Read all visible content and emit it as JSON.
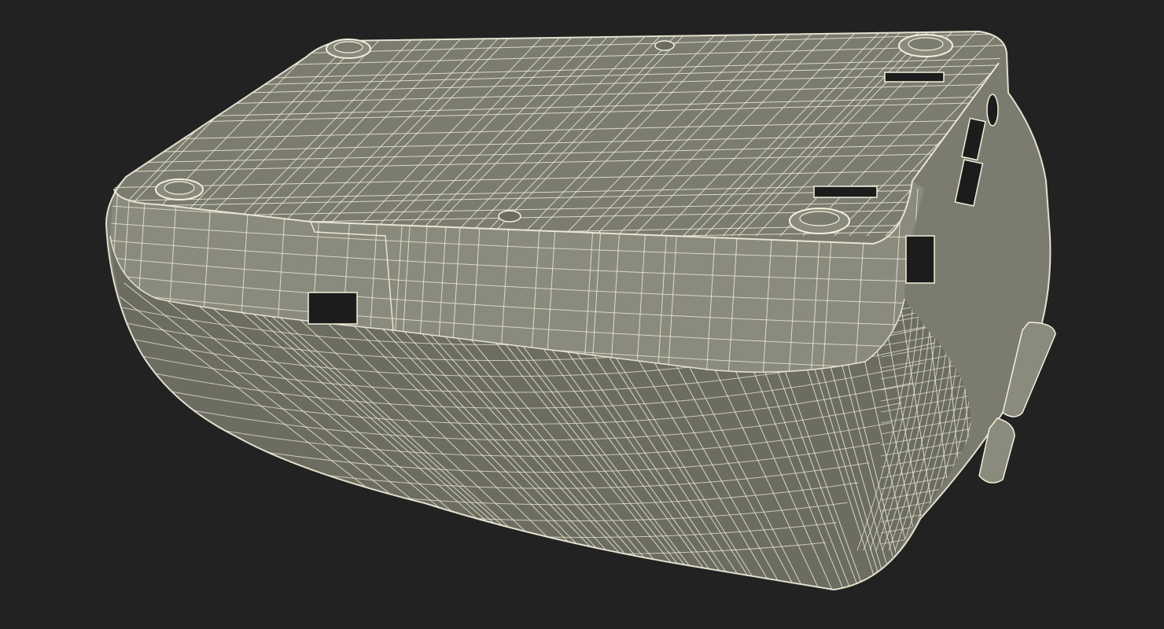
{
  "scene": {
    "subject": "wireframe-3d-model",
    "colors": {
      "background": "#222222",
      "surface": "#7b7b6f",
      "surface_dark": "#6c6c61",
      "surface_light": "#8a8a7d",
      "wire": "#f2f0dc",
      "hole": "#1c1c1c"
    },
    "feet_count": 4,
    "screw_count": 2,
    "visible_text": []
  }
}
